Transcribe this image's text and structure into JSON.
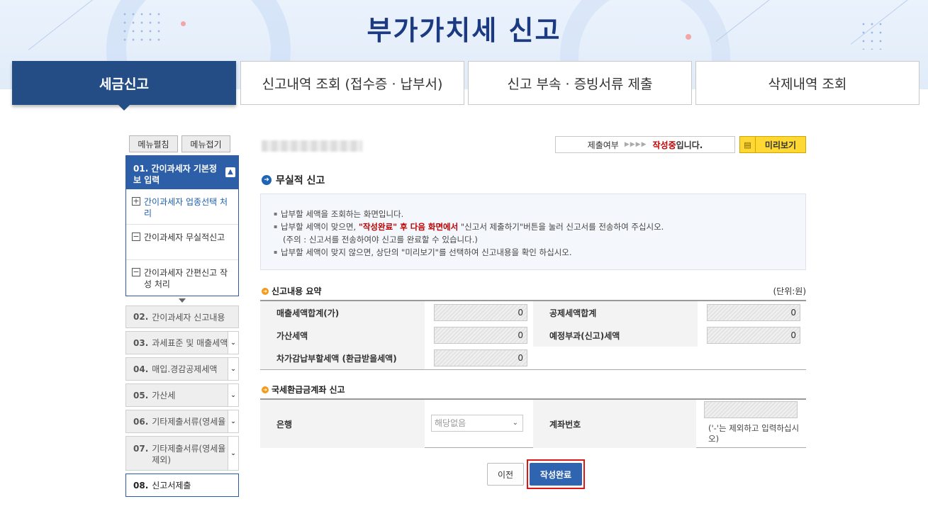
{
  "page": {
    "title": "부가가치세 신고"
  },
  "top_tabs": [
    {
      "label": "세금신고",
      "active": true
    },
    {
      "label": "신고내역 조회 (접수증 · 납부서)",
      "active": false
    },
    {
      "label": "신고 부속 · 증빙서류 제출",
      "active": false
    },
    {
      "label": "삭제내역 조회",
      "active": false
    }
  ],
  "sidebar": {
    "expand_all": "메뉴펼침",
    "collapse_all": "메뉴접기",
    "active_step": {
      "label": "01. 간이과세자 기본정보 입력",
      "children": [
        {
          "label": "간이과세자 업종선택 처리",
          "icon": "plus-box-icon",
          "link": true
        },
        {
          "label": "간이과세자 무실적신고",
          "icon": "minus-box-icon",
          "link": false
        },
        {
          "label": "간이과세자 간편신고 작성 처리",
          "icon": "minus-box-icon",
          "link": false
        }
      ]
    },
    "steps": [
      {
        "num": "02.",
        "label": "간이과세자 신고내용",
        "has_select": false
      },
      {
        "num": "03.",
        "label": "과세표준 및 매출세액",
        "has_select": true
      },
      {
        "num": "04.",
        "label": "매입.경감공제세액",
        "has_select": true
      },
      {
        "num": "05.",
        "label": "가산세",
        "has_select": true
      },
      {
        "num": "06.",
        "label": "기타제출서류(영세율",
        "has_select": true
      },
      {
        "num": "07.",
        "label": "기타제출서류(영세율 제외)",
        "has_select": true
      },
      {
        "num": "08.",
        "label": "신고서제출",
        "has_select": false,
        "current": true
      }
    ]
  },
  "status": {
    "prefix": "제출여부",
    "arrows": "▶▶▶▶",
    "state": "작성중",
    "suffix": "입니다.",
    "preview_label": "미리보기"
  },
  "section": {
    "title": "무실적 신고",
    "info": {
      "line1": "납부할 세액을 조회하는 화면입니다.",
      "line2_a": "납부할 세액이 맞으면, ",
      "line2_red": "\"작성완료\" 후 다음 화면에서",
      "line2_b": " \"신고서 제출하기\"버튼을 눌러 신고서를 전송하여 주십시오.",
      "line3": "(주의 : 신고서를 전송하여야 신고를 완료할 수 있습니다.)",
      "line4": "납부할 세액이 맞지 않으면, 상단의 \"미리보기\"를 선택하여 신고내용을 확인 하십시오."
    }
  },
  "summary": {
    "title": "신고내용 요약",
    "unit": "(단위:원)",
    "rows": [
      {
        "label_left": "매출세액합계(가)",
        "value_left": "0",
        "label_right": "공제세액합계",
        "value_right": "0"
      },
      {
        "label_left": "가산세액",
        "value_left": "0",
        "label_right": "예정부과(신고)세액",
        "value_right": "0"
      },
      {
        "label_left": "차가감납부할세액 (환급받을세액)",
        "value_left": "0"
      }
    ]
  },
  "refund": {
    "title": "국세환급금계좌 신고",
    "bank_label": "은행",
    "bank_selected": "해당없음",
    "account_label": "계좌번호",
    "account_value": "",
    "account_note": "('-'는 제외하고 입력하십시오)"
  },
  "buttons": {
    "prev": "이전",
    "done": "작성완료"
  }
}
